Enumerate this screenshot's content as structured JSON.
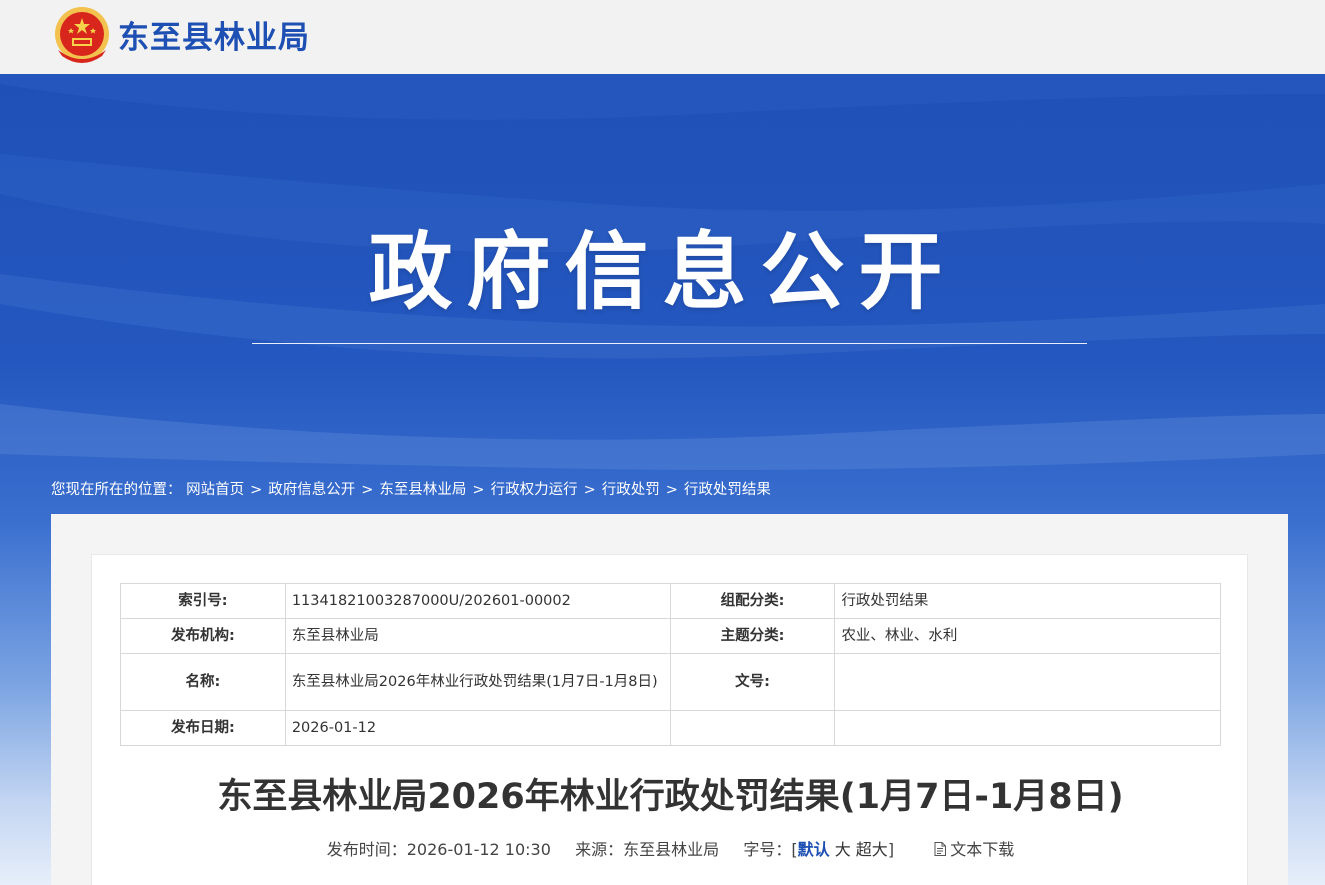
{
  "header": {
    "site_name": "东至县林业局",
    "emblem_icon": "national-emblem-icon"
  },
  "banner": {
    "title": "政府信息公开"
  },
  "breadcrumb": {
    "prefix": "您现在所在的位置：",
    "separator": ">",
    "items": [
      "网站首页",
      "政府信息公开",
      "东至县林业局",
      "行政权力运行",
      "行政处罚",
      "行政处罚结果"
    ]
  },
  "meta": {
    "index_label": "索引号:",
    "index_value": "11341821003287000U/202601-00002",
    "category_label": "组配分类:",
    "category_value": "行政处罚结果",
    "publisher_label": "发布机构:",
    "publisher_value": "东至县林业局",
    "topic_label": "主题分类:",
    "topic_value": "农业、林业、水利",
    "name_label": "名称:",
    "name_value": "东至县林业局2026年林业行政处罚结果(1月7日-1月8日)",
    "docno_label": "文号:",
    "docno_value": "",
    "date_label": "发布日期:",
    "date_value": "2026-01-12"
  },
  "article": {
    "title": "东至县林业局2026年林业行政处罚结果(1月7日-1月8日)",
    "publish_time_label": "发布时间：",
    "publish_time": "2026-01-12 10:30",
    "source_label": "来源：",
    "source": "东至县林业局",
    "font_size_label": "字号：[",
    "font_default": "默认",
    "font_large": "大",
    "font_xlarge": "超大",
    "font_close": "]",
    "download_label": "文本下载",
    "download_icon": "document-icon"
  },
  "colors": {
    "brand_blue": "#1e4fb3",
    "banner_blue": "#2457bf"
  }
}
